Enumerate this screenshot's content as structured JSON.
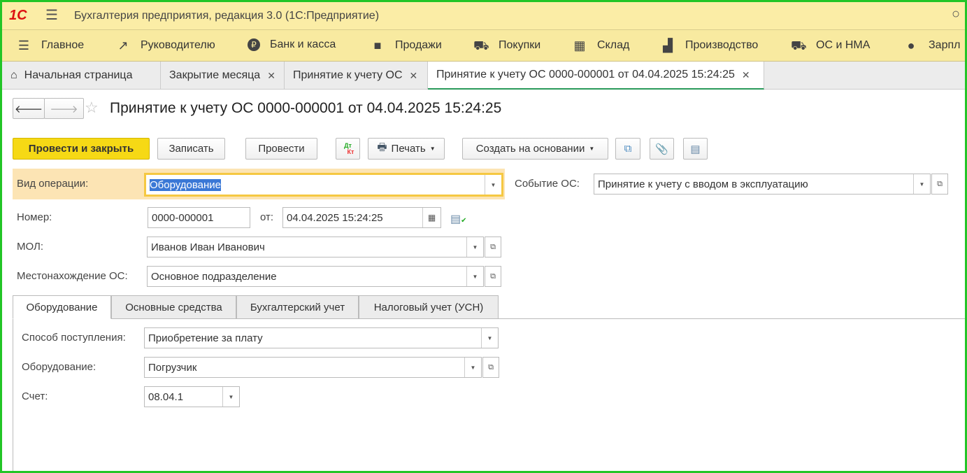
{
  "app": {
    "logo": "1С",
    "title": "Бухгалтерия предприятия, редакция 3.0  (1С:Предприятие)"
  },
  "nav": [
    {
      "label": "Главное",
      "icon": "menu-icon"
    },
    {
      "label": "Руководителю",
      "icon": "trend-icon"
    },
    {
      "label": "Банк и касса",
      "icon": "ruble-icon"
    },
    {
      "label": "Продажи",
      "icon": "bag-icon"
    },
    {
      "label": "Покупки",
      "icon": "cart-icon"
    },
    {
      "label": "Склад",
      "icon": "grid-icon"
    },
    {
      "label": "Производство",
      "icon": "factory-icon"
    },
    {
      "label": "ОС и НМА",
      "icon": "truck-icon"
    },
    {
      "label": "Зарпл",
      "icon": "person-icon"
    }
  ],
  "tabs": [
    {
      "label": "Начальная страница"
    },
    {
      "label": "Закрытие месяца"
    },
    {
      "label": "Принятие к учету ОС"
    },
    {
      "label": "Принятие к учету ОС 0000-000001 от 04.04.2025 15:24:25"
    }
  ],
  "doc": {
    "title": "Принятие к учету ОС 0000-000001 от 04.04.2025 15:24:25"
  },
  "toolbar": {
    "post_close": "Провести и закрыть",
    "save": "Записать",
    "post": "Провести",
    "dtkt_dt": "Дт",
    "dtkt_kt": "Кт",
    "print": "Печать",
    "create_based": "Создать на основании"
  },
  "form": {
    "op_label": "Вид операции:",
    "op_value": "Оборудование",
    "event_label": "Событие ОС:",
    "event_value": "Принятие к учету с вводом в эксплуатацию",
    "num_label": "Номер:",
    "num_value": "0000-000001",
    "from_label": "от:",
    "date_value": "04.04.2025 15:24:25",
    "mol_label": "МОЛ:",
    "mol_value": "Иванов Иван Иванович",
    "loc_label": "Местонахождение ОС:",
    "loc_value": "Основное подразделение"
  },
  "form_tabs": [
    "Оборудование",
    "Основные средства",
    "Бухгалтерский учет",
    "Налоговый учет (УСН)"
  ],
  "equipment": {
    "method_label": "Способ поступления:",
    "method_value": "Приобретение за плату",
    "equip_label": "Оборудование:",
    "equip_value": "Погрузчик",
    "account_label": "Счет:",
    "account_value": "08.04.1"
  }
}
